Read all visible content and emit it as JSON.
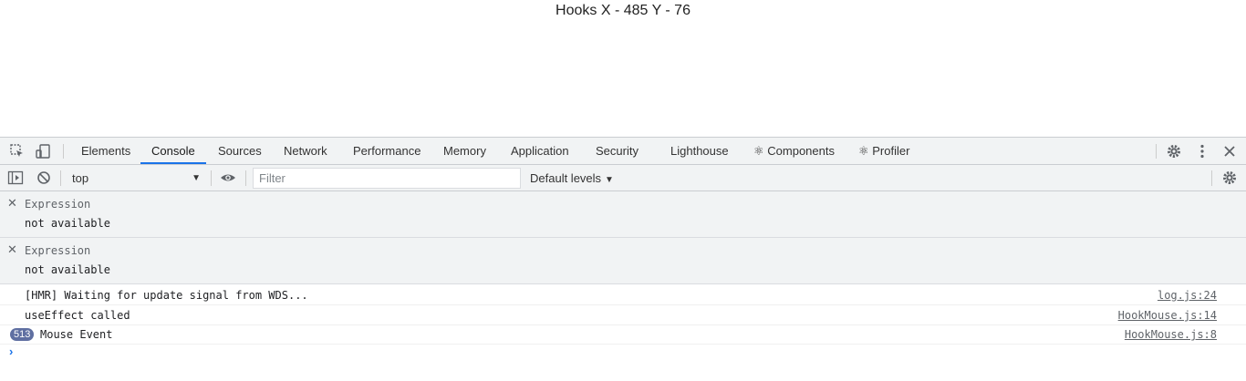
{
  "page": {
    "heading": "Hooks X - 485 Y - 76"
  },
  "devtools": {
    "tabs": [
      "Elements",
      "Console",
      "Sources",
      "Network",
      "Performance",
      "Memory",
      "Application",
      "Security",
      "Lighthouse",
      "⚛ Components",
      "⚛ Profiler"
    ],
    "active_tab": "Console",
    "toolbar_icons": [
      "inspect-element-icon",
      "device-toolbar-icon",
      "settings-icon",
      "more-vertical-icon",
      "close-icon"
    ]
  },
  "console_toolbar": {
    "context": "top",
    "filter_placeholder": "Filter",
    "filter_value": "",
    "levels": "Default levels",
    "icons": [
      "sidebar-toggle-icon",
      "clear-console-icon",
      "live-expression-icon",
      "console-settings-icon"
    ]
  },
  "expressions": [
    {
      "label": "Expression",
      "value": "not available"
    },
    {
      "label": "Expression",
      "value": "not available"
    }
  ],
  "messages": [
    {
      "text": "[HMR] Waiting for update signal from WDS...",
      "source": "log.js:24"
    },
    {
      "text": "useEffect called",
      "source": "HookMouse.js:14"
    },
    {
      "text": "Mouse Event",
      "source": "HookMouse.js:8",
      "repeat_count": "513"
    }
  ],
  "colors": {
    "accent": "#1a73e8",
    "toolbar_bg": "#f1f3f4",
    "badge": "#5f6fa1"
  }
}
